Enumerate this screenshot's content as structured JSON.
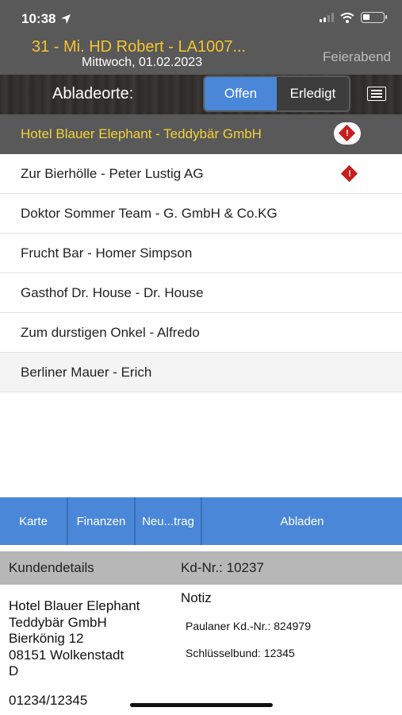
{
  "status": {
    "time": "10:38"
  },
  "header": {
    "tour_title": "31 - Mi. HD Robert - LA1007...",
    "date": "Mittwoch, 01.02.2023",
    "end_button": "Feierabend"
  },
  "tabbar": {
    "label": "Abladeorte:",
    "tabs": [
      {
        "label": "Offen"
      },
      {
        "label": "Erledigt"
      }
    ]
  },
  "locations": [
    {
      "label": "Hotel Blauer Elephant - Teddybär GmbH"
    },
    {
      "label": "Zur Bierhölle - Peter Lustig AG"
    },
    {
      "label": "Doktor Sommer Team - G. GmbH & Co.KG"
    },
    {
      "label": "Frucht Bar - Homer Simpson"
    },
    {
      "label": "Gasthof Dr. House - Dr. House"
    },
    {
      "label": "Zum durstigen Onkel - Alfredo"
    },
    {
      "label": "Berliner Mauer - Erich"
    }
  ],
  "warning_mark": "!",
  "actions": {
    "map": "Karte",
    "finance": "Finanzen",
    "new_entry": "Neu...trag",
    "unload": "Abladen"
  },
  "customer": {
    "section_title": "Kundendetails",
    "customer_no": "Kd-Nr.: 10237",
    "address": [
      "Hotel Blauer Elephant",
      "Teddybär GmbH",
      "Bierkönig 12",
      "08151 Wolkenstadt",
      "D"
    ],
    "phone": "01234/12345",
    "note_title": "Notiz",
    "notes": [
      "Paulaner Kd.-Nr.: 824979",
      "Schlüsselbund: 12345"
    ]
  },
  "colors": {
    "header_bg": "#595959",
    "title_yellow": "#f4c430",
    "accent_blue": "#4a87d8",
    "warning_red": "#c81d1d"
  }
}
